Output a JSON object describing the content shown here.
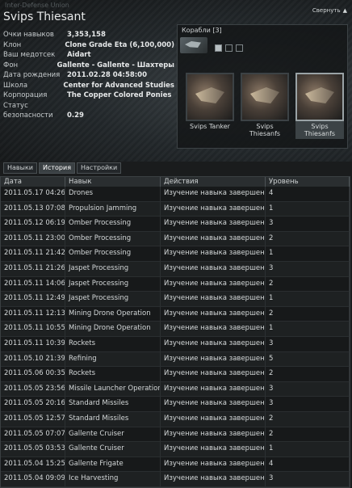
{
  "window": {
    "corner_text": "Inter-Defense Union",
    "collapse_label": "Свернуть",
    "title": "Svips Thiesant"
  },
  "info": [
    {
      "key": "Очки навыков",
      "value": "3,353,158"
    },
    {
      "key": "Клон",
      "value": "Clone Grade Eta (6,100,000)"
    },
    {
      "key": "Ваш медотсек",
      "value": "Aidart"
    },
    {
      "key": "Фон",
      "value": "Gallente - Gallente - Шахтеры"
    },
    {
      "key": "Дата рождения",
      "value": "2011.02.28 04:58:00"
    },
    {
      "key": "Школа",
      "value": "Center for Advanced Studies"
    },
    {
      "key": "Корпорация",
      "value": "The Copper Colored Ponies"
    },
    {
      "key": "Статус",
      "value": ""
    },
    {
      "key": "безопасности",
      "value": "0.29"
    }
  ],
  "ships": {
    "header": "Корабли [3]",
    "cards": [
      {
        "name": "Svips Tanker",
        "selected": false
      },
      {
        "name": "Svips Thiesanfs",
        "selected": false
      },
      {
        "name": "Svips Thiesanfs",
        "selected": true
      }
    ]
  },
  "tabs": [
    {
      "label": "Навыки",
      "active": false
    },
    {
      "label": "История",
      "active": true
    },
    {
      "label": "Настройки",
      "active": false
    }
  ],
  "table": {
    "headers": [
      "Дата",
      "Навык",
      "Действия",
      "Уровень"
    ],
    "rows": [
      [
        "2011.05.17 04:26",
        "Drones",
        "Изучение навыка завершено",
        "4"
      ],
      [
        "2011.05.13 07:08",
        "Propulsion Jamming",
        "Изучение навыка завершено",
        "1"
      ],
      [
        "2011.05.12 06:19",
        "Omber Processing",
        "Изучение навыка завершено",
        "3"
      ],
      [
        "2011.05.11 23:00",
        "Omber Processing",
        "Изучение навыка завершено",
        "2"
      ],
      [
        "2011.05.11 21:42",
        "Omber Processing",
        "Изучение навыка завершено",
        "1"
      ],
      [
        "2011.05.11 21:26",
        "Jaspet Processing",
        "Изучение навыка завершено",
        "3"
      ],
      [
        "2011.05.11 14:06",
        "Jaspet Processing",
        "Изучение навыка завершено",
        "2"
      ],
      [
        "2011.05.11 12:49",
        "Jaspet Processing",
        "Изучение навыка завершено",
        "1"
      ],
      [
        "2011.05.11 12:13",
        "Mining Drone Operation",
        "Изучение навыка завершено",
        "2"
      ],
      [
        "2011.05.11 10:55",
        "Mining Drone Operation",
        "Изучение навыка завершено",
        "1"
      ],
      [
        "2011.05.11 10:39",
        "Rockets",
        "Изучение навыка завершено",
        "3"
      ],
      [
        "2011.05.10 21:39",
        "Refining",
        "Изучение навыка завершено",
        "5"
      ],
      [
        "2011.05.06 00:35",
        "Rockets",
        "Изучение навыка завершено",
        "2"
      ],
      [
        "2011.05.05 23:56",
        "Missile Launcher Operation",
        "Изучение навыка завершено",
        "3"
      ],
      [
        "2011.05.05 20:16",
        "Standard Missiles",
        "Изучение навыка завершено",
        "3"
      ],
      [
        "2011.05.05 12:57",
        "Standard Missiles",
        "Изучение навыка завершено",
        "2"
      ],
      [
        "2011.05.05 07:07",
        "Gallente Cruiser",
        "Изучение навыка завершено",
        "2"
      ],
      [
        "2011.05.05 03:53",
        "Gallente Cruiser",
        "Изучение навыка завершено",
        "1"
      ],
      [
        "2011.05.04 15:25",
        "Gallente Frigate",
        "Изучение навыка завершено",
        "4"
      ],
      [
        "2011.05.04 09:09",
        "Ice Harvesting",
        "Изучение навыка завершено",
        "3"
      ]
    ]
  }
}
